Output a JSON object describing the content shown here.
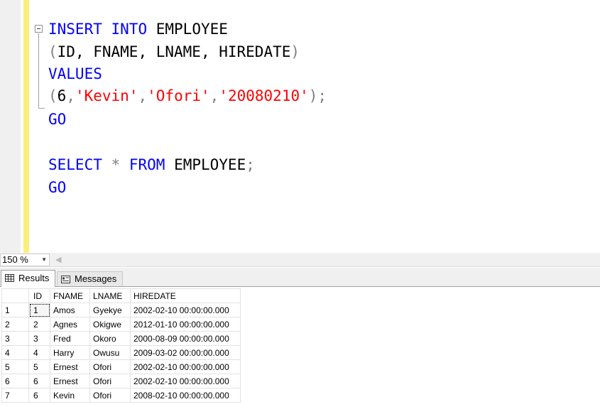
{
  "editor": {
    "lines": {
      "l1_kw1": "INSERT",
      "l1_kw2": "INTO",
      "l1_id": "EMPLOYEE",
      "l2_open": "(",
      "l2_cols": "ID, FNAME, LNAME, HIREDATE",
      "l2_close": ")",
      "l3_kw": "VALUES",
      "l4_open": "(",
      "l4_num": "6",
      "l4_comma1": ",",
      "l4_s1": "'Kevin'",
      "l4_comma2": ",",
      "l4_s2": "'Ofori'",
      "l4_comma3": ",",
      "l4_s3": "'20080210'",
      "l4_close": ");",
      "l5_kw": "GO",
      "l7_kw1": "SELECT",
      "l7_star": "*",
      "l7_kw2": "FROM",
      "l7_id": "EMPLOYEE",
      "l7_semi": ";",
      "l8_kw": "GO"
    }
  },
  "zoom": {
    "value": "150 %"
  },
  "tabs": {
    "results": "Results",
    "messages": "Messages"
  },
  "grid": {
    "headers": [
      "",
      "ID",
      "FNAME",
      "LNAME",
      "HIREDATE"
    ],
    "rows": [
      [
        "1",
        "1",
        "Amos",
        "Gyekye",
        "2002-02-10 00:00:00.000"
      ],
      [
        "2",
        "2",
        "Agnes",
        "Okigwe",
        "2012-01-10 00:00:00.000"
      ],
      [
        "3",
        "3",
        "Fred",
        "Okoro",
        "2000-08-09 00:00:00.000"
      ],
      [
        "4",
        "4",
        "Harry",
        "Owusu",
        "2009-03-02 00:00:00.000"
      ],
      [
        "5",
        "5",
        "Ernest",
        "Ofori",
        "2002-02-10 00:00:00.000"
      ],
      [
        "6",
        "6",
        "Ernest",
        "Ofori",
        "2002-02-10 00:00:00.000"
      ],
      [
        "7",
        "6",
        "Kevin",
        "Ofori",
        "2008-02-10 00:00:00.000"
      ]
    ]
  },
  "colors": {
    "keyword": "#0000ff",
    "string": "#ff0000",
    "operator": "#808080",
    "changebar": "#fbee7e"
  }
}
